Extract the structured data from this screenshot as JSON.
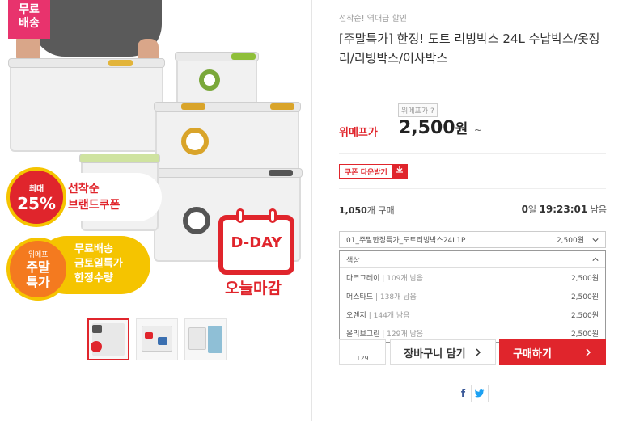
{
  "left": {
    "free_shipping": "무료\n배송",
    "coupon_circle": {
      "line1": "최대",
      "line2": "25%"
    },
    "coupon_text": {
      "line1": "선착순",
      "line2": "브랜드쿠폰"
    },
    "weekend_circle": {
      "line1": "위메프",
      "line2": "주말",
      "line3": "특가"
    },
    "weekend_text": {
      "line1": "무료배송",
      "line2": "금토일특가",
      "line3": "한정수량"
    },
    "dday": "D-DAY",
    "deadline": "오늘마감",
    "thumbnails": [
      {
        "name": "thumb-1",
        "active": true
      },
      {
        "name": "thumb-2",
        "active": false
      },
      {
        "name": "thumb-3",
        "active": false
      }
    ]
  },
  "right": {
    "promo_tag": "선착순! 역대급 할인",
    "title": "[주말특가] 한정! 도트 리빙박스 24L 수납박스/옷정리/리빙박스/이사박스",
    "price_tip": "위메프가 ?",
    "price_label": "위메프가",
    "price": "2,500",
    "price_unit": "원",
    "price_tilde": "~",
    "coupon_button": "쿠폰 다운받기",
    "buy_count_number": "1,050",
    "buy_count_suffix": "개 구매",
    "timer": {
      "days": "0",
      "days_unit": "일",
      "time": "19:23:01",
      "suffix": "남음"
    },
    "option_select": {
      "name": "01_주말한정특가_도트리빙박스24L1P",
      "value": "2,500원"
    },
    "dropdown": {
      "header": "색상",
      "options": [
        {
          "name": "다크그레이",
          "stock": "| 109개 남음",
          "price": "2,500원"
        },
        {
          "name": "머스타드",
          "stock": "| 138개 남음",
          "price": "2,500원"
        },
        {
          "name": "오렌지",
          "stock": "| 144개 남음",
          "price": "2,500원"
        },
        {
          "name": "올리브그린",
          "stock": "| 129개 남음",
          "price": "2,500원"
        }
      ]
    },
    "wish_count": "129",
    "cart_button": "장바구니 담기",
    "buy_button": "구매하기",
    "share": {
      "facebook": "f",
      "twitter": "t"
    }
  },
  "colors": {
    "accent": "#e0252c",
    "pink": "#e8336d",
    "yellow": "#f5c400",
    "orange": "#f47a1f"
  }
}
